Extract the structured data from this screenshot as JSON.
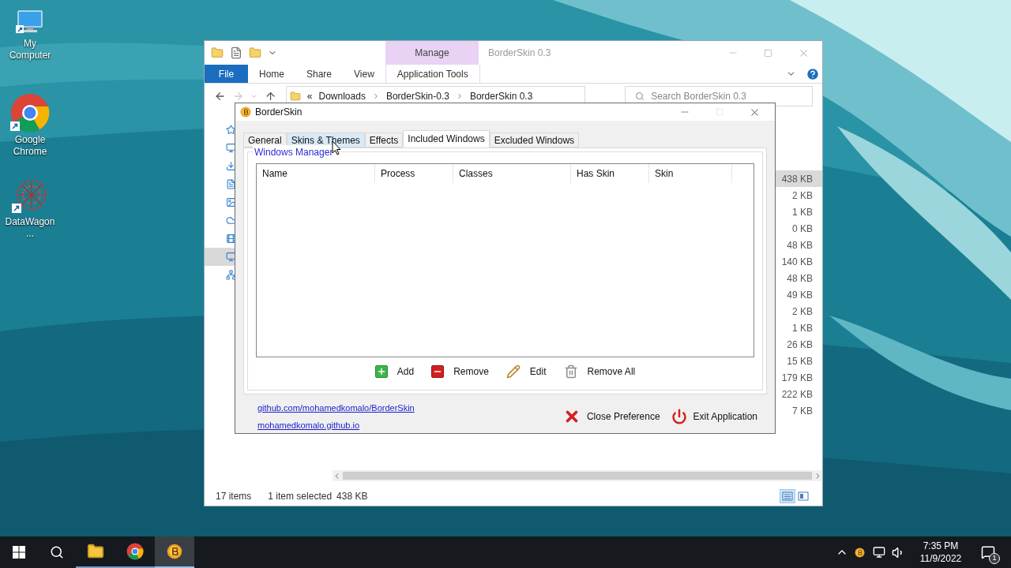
{
  "desktop": {
    "icons": [
      {
        "label": "My Computer",
        "kind": "computer"
      },
      {
        "label": "Google Chrome",
        "kind": "chrome"
      },
      {
        "label": "DataWagon...",
        "kind": "datawagon"
      }
    ]
  },
  "explorer": {
    "title": "BorderSkin 0.3",
    "context_group": "Manage",
    "ribbon_tabs": [
      {
        "label": "File",
        "kind": "file"
      },
      {
        "label": "Home",
        "kind": "plain"
      },
      {
        "label": "Share",
        "kind": "plain"
      },
      {
        "label": "View",
        "kind": "plain"
      },
      {
        "label": "Application Tools",
        "kind": "context"
      }
    ],
    "breadcrumb": {
      "overflow": "«",
      "parts": [
        "Downloads",
        "BorderSkin-0.3",
        "BorderSkin 0.3"
      ]
    },
    "search": {
      "placeholder": "Search BorderSkin 0.3"
    },
    "nav_items": [
      {
        "kind": "star",
        "selected": false
      },
      {
        "kind": "desktop",
        "selected": false
      },
      {
        "kind": "download",
        "selected": false
      },
      {
        "kind": "document",
        "selected": false
      },
      {
        "kind": "picture",
        "selected": false
      },
      {
        "kind": "cloud",
        "selected": false
      },
      {
        "kind": "video",
        "selected": false
      },
      {
        "kind": "pc",
        "selected": true
      },
      {
        "kind": "network",
        "selected": false
      }
    ],
    "sizes": [
      {
        "text": "438 KB",
        "selected": true
      },
      {
        "text": "2 KB",
        "selected": false
      },
      {
        "text": "1 KB",
        "selected": false
      },
      {
        "text": "0 KB",
        "selected": false
      },
      {
        "text": "48 KB",
        "selected": false
      },
      {
        "text": "140 KB",
        "selected": false
      },
      {
        "text": "48 KB",
        "selected": false
      },
      {
        "text": "49 KB",
        "selected": false
      },
      {
        "text": "2 KB",
        "selected": false
      },
      {
        "text": "1 KB",
        "selected": false
      },
      {
        "text": "26 KB",
        "selected": false
      },
      {
        "text": "15 KB",
        "selected": false
      },
      {
        "text": "179 KB",
        "selected": false
      },
      {
        "text": "222 KB",
        "selected": false
      },
      {
        "text": "7 KB",
        "selected": false
      }
    ],
    "status_bar": {
      "item_count": "17 items",
      "selection": "1 item selected",
      "selection_size": "438 KB"
    },
    "view_buttons": [
      {
        "kind": "details",
        "selected": true
      },
      {
        "kind": "tiles",
        "selected": false
      }
    ]
  },
  "dialog": {
    "title": "BorderSkin",
    "tabs": [
      {
        "label": "General",
        "selected": false,
        "hovered": false
      },
      {
        "label": "Skins & Themes",
        "selected": false,
        "hovered": true
      },
      {
        "label": "Effects",
        "selected": false,
        "hovered": false
      },
      {
        "label": "Included Windows",
        "selected": true,
        "hovered": false
      },
      {
        "label": "Excluded Windows",
        "selected": false,
        "hovered": false
      }
    ],
    "group_title": "Windows Manager",
    "columns": [
      "Name",
      "Process",
      "Classes",
      "Has Skin",
      "Skin"
    ],
    "actions": [
      {
        "label": "Add",
        "kind": "add"
      },
      {
        "label": "Remove",
        "kind": "remove"
      },
      {
        "label": "Edit",
        "kind": "edit"
      },
      {
        "label": "Remove All",
        "kind": "remove_all"
      }
    ],
    "links": [
      "github.com/mohamedkomalo/BorderSkin",
      "mohamedkomalo.github.io"
    ],
    "buttons": [
      {
        "label": "Close Preference",
        "kind": "close"
      },
      {
        "label": "Exit Application",
        "kind": "exit"
      }
    ]
  },
  "taskbar": {
    "apps": [
      {
        "kind": "explorer",
        "selected": false
      },
      {
        "kind": "chrome",
        "selected": false
      },
      {
        "kind": "borderskin",
        "selected": true
      }
    ],
    "time": "7:35 PM",
    "date": "11/9/2022",
    "notification_count": "1"
  }
}
